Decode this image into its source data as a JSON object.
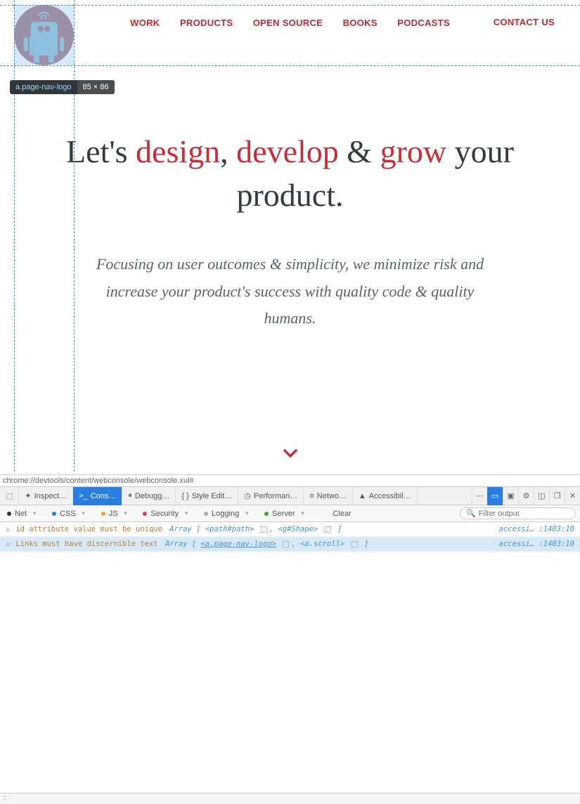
{
  "inspector": {
    "highlight_selector": "a.page-nav-logo",
    "highlight_dims": "85 × 86"
  },
  "nav": {
    "items": [
      "WORK",
      "PRODUCTS",
      "OPEN SOURCE",
      "BOOKS",
      "PODCASTS"
    ],
    "contact": "CONTACT US"
  },
  "hero": {
    "t1": "Let's ",
    "t2": "design",
    "t3": ", ",
    "t4": "develop",
    "t5": " & ",
    "t6": "grow",
    "t7": " your product.",
    "sub": "Focusing on user outcomes & simplicity, we minimize risk and increase your product's success with quality code & quality humans."
  },
  "url": "chrome://devtools/content/webconsole/webconsole.xul#",
  "devtools": {
    "tabs": {
      "inspector": "Inspect…",
      "console": "Cons…",
      "debugger": "Debugg…",
      "style": "Style Edit…",
      "perf": "Performan…",
      "network": "Netwo…",
      "access": "Accessibil…"
    },
    "filters": {
      "net": "Net",
      "css": "CSS",
      "js": "JS",
      "security": "Security",
      "logging": "Logging",
      "server": "Server",
      "clear": "Clear",
      "search_placeholder": "Filter output"
    },
    "messages": [
      {
        "text": "id attribute value must be unique",
        "arr": "Array",
        "el1": "<path#path>",
        "el2": "<g#Shape>",
        "loc": "accessi… :1403:10"
      },
      {
        "text": "Links must have discernible text",
        "arr": "Array",
        "el1": "<a.page-nav-logo>",
        "el2": "<a.scroll>",
        "loc": "accessi… :1403:10"
      }
    ]
  },
  "statusbar": "::"
}
